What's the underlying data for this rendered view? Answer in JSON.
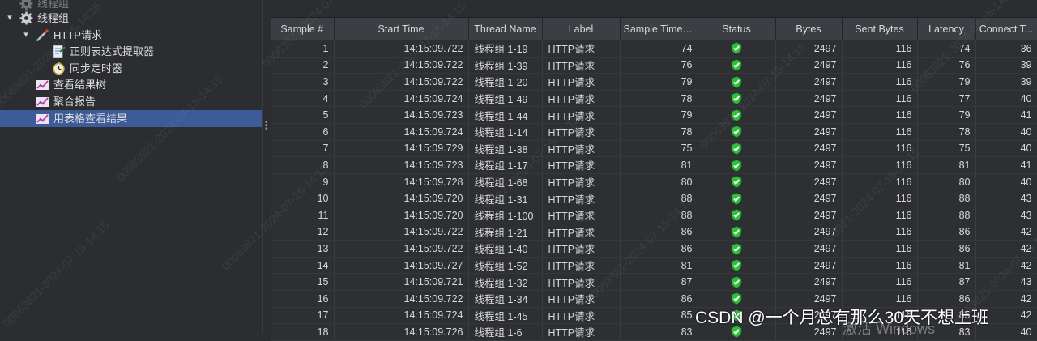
{
  "tree": {
    "items": [
      {
        "label": "线程组",
        "icon": "gear-icon",
        "level": 0,
        "chevron": "",
        "dim": true
      },
      {
        "label": "线程组",
        "icon": "gear-icon",
        "level": 0,
        "chevron": "▾"
      },
      {
        "label": "HTTP请求",
        "icon": "pipette-icon",
        "level": 1,
        "chevron": "▾"
      },
      {
        "label": "正则表达式提取器",
        "icon": "extractor-icon",
        "level": 2,
        "chevron": ""
      },
      {
        "label": "同步定时器",
        "icon": "timer-icon",
        "level": 2,
        "chevron": ""
      },
      {
        "label": "查看结果树",
        "icon": "graph-icon",
        "level": 1,
        "chevron": ""
      },
      {
        "label": "聚合报告",
        "icon": "graph-icon",
        "level": 1,
        "chevron": ""
      },
      {
        "label": "用表格查看结果",
        "icon": "graph-icon",
        "level": 1,
        "chevron": "",
        "selected": true
      }
    ]
  },
  "table": {
    "columns": [
      "Sample #",
      "Start Time",
      "Thread Name",
      "Label",
      "Sample Time(...",
      "Status",
      "Bytes",
      "Sent Bytes",
      "Latency",
      "Connect T..."
    ],
    "rows": [
      [
        "1",
        "14:15:09.722",
        "线程组 1-19",
        "HTTP请求",
        "74",
        "ok",
        "2497",
        "116",
        "74",
        "36"
      ],
      [
        "2",
        "14:15:09.722",
        "线程组 1-39",
        "HTTP请求",
        "76",
        "ok",
        "2497",
        "116",
        "76",
        "39"
      ],
      [
        "3",
        "14:15:09.722",
        "线程组 1-20",
        "HTTP请求",
        "79",
        "ok",
        "2497",
        "116",
        "79",
        "39"
      ],
      [
        "4",
        "14:15:09.724",
        "线程组 1-49",
        "HTTP请求",
        "78",
        "ok",
        "2497",
        "116",
        "77",
        "40"
      ],
      [
        "5",
        "14:15:09.723",
        "线程组 1-44",
        "HTTP请求",
        "79",
        "ok",
        "2497",
        "116",
        "79",
        "41"
      ],
      [
        "6",
        "14:15:09.724",
        "线程组 1-14",
        "HTTP请求",
        "78",
        "ok",
        "2497",
        "116",
        "78",
        "40"
      ],
      [
        "7",
        "14:15:09.729",
        "线程组 1-38",
        "HTTP请求",
        "75",
        "ok",
        "2497",
        "116",
        "75",
        "40"
      ],
      [
        "8",
        "14:15:09.723",
        "线程组 1-17",
        "HTTP请求",
        "81",
        "ok",
        "2497",
        "116",
        "81",
        "41"
      ],
      [
        "9",
        "14:15:09.728",
        "线程组 1-68",
        "HTTP请求",
        "80",
        "ok",
        "2497",
        "116",
        "80",
        "40"
      ],
      [
        "10",
        "14:15:09.720",
        "线程组 1-31",
        "HTTP请求",
        "88",
        "ok",
        "2497",
        "116",
        "88",
        "43"
      ],
      [
        "11",
        "14:15:09.720",
        "线程组 1-100",
        "HTTP请求",
        "88",
        "ok",
        "2497",
        "116",
        "88",
        "43"
      ],
      [
        "12",
        "14:15:09.722",
        "线程组 1-21",
        "HTTP请求",
        "86",
        "ok",
        "2497",
        "116",
        "86",
        "42"
      ],
      [
        "13",
        "14:15:09.722",
        "线程组 1-40",
        "HTTP请求",
        "86",
        "ok",
        "2497",
        "116",
        "86",
        "42"
      ],
      [
        "14",
        "14:15:09.727",
        "线程组 1-52",
        "HTTP请求",
        "81",
        "ok",
        "2497",
        "116",
        "81",
        "42"
      ],
      [
        "15",
        "14:15:09.721",
        "线程组 1-32",
        "HTTP请求",
        "87",
        "ok",
        "2497",
        "116",
        "87",
        "43"
      ],
      [
        "16",
        "14:15:09.722",
        "线程组 1-34",
        "HTTP请求",
        "86",
        "ok",
        "2497",
        "116",
        "86",
        "42"
      ],
      [
        "17",
        "14:15:09.724",
        "线程组 1-45",
        "HTTP请求",
        "85",
        "ok",
        "2497",
        "116",
        "85",
        "42"
      ],
      [
        "18",
        "14:15:09.726",
        "线程组 1-6",
        "HTTP请求",
        "83",
        "ok",
        "2497",
        "116",
        "83",
        "40"
      ]
    ]
  },
  "watermark_text": "00063821-2024-07-15-14:15",
  "overlay": {
    "windows_activation": "激活 Windows",
    "credit": "CSDN @一个月总有那么30天不想上班"
  },
  "colors": {
    "selection": "#3d5a99",
    "status_ok": "#2fbf3c",
    "background": "#2b2d30"
  }
}
